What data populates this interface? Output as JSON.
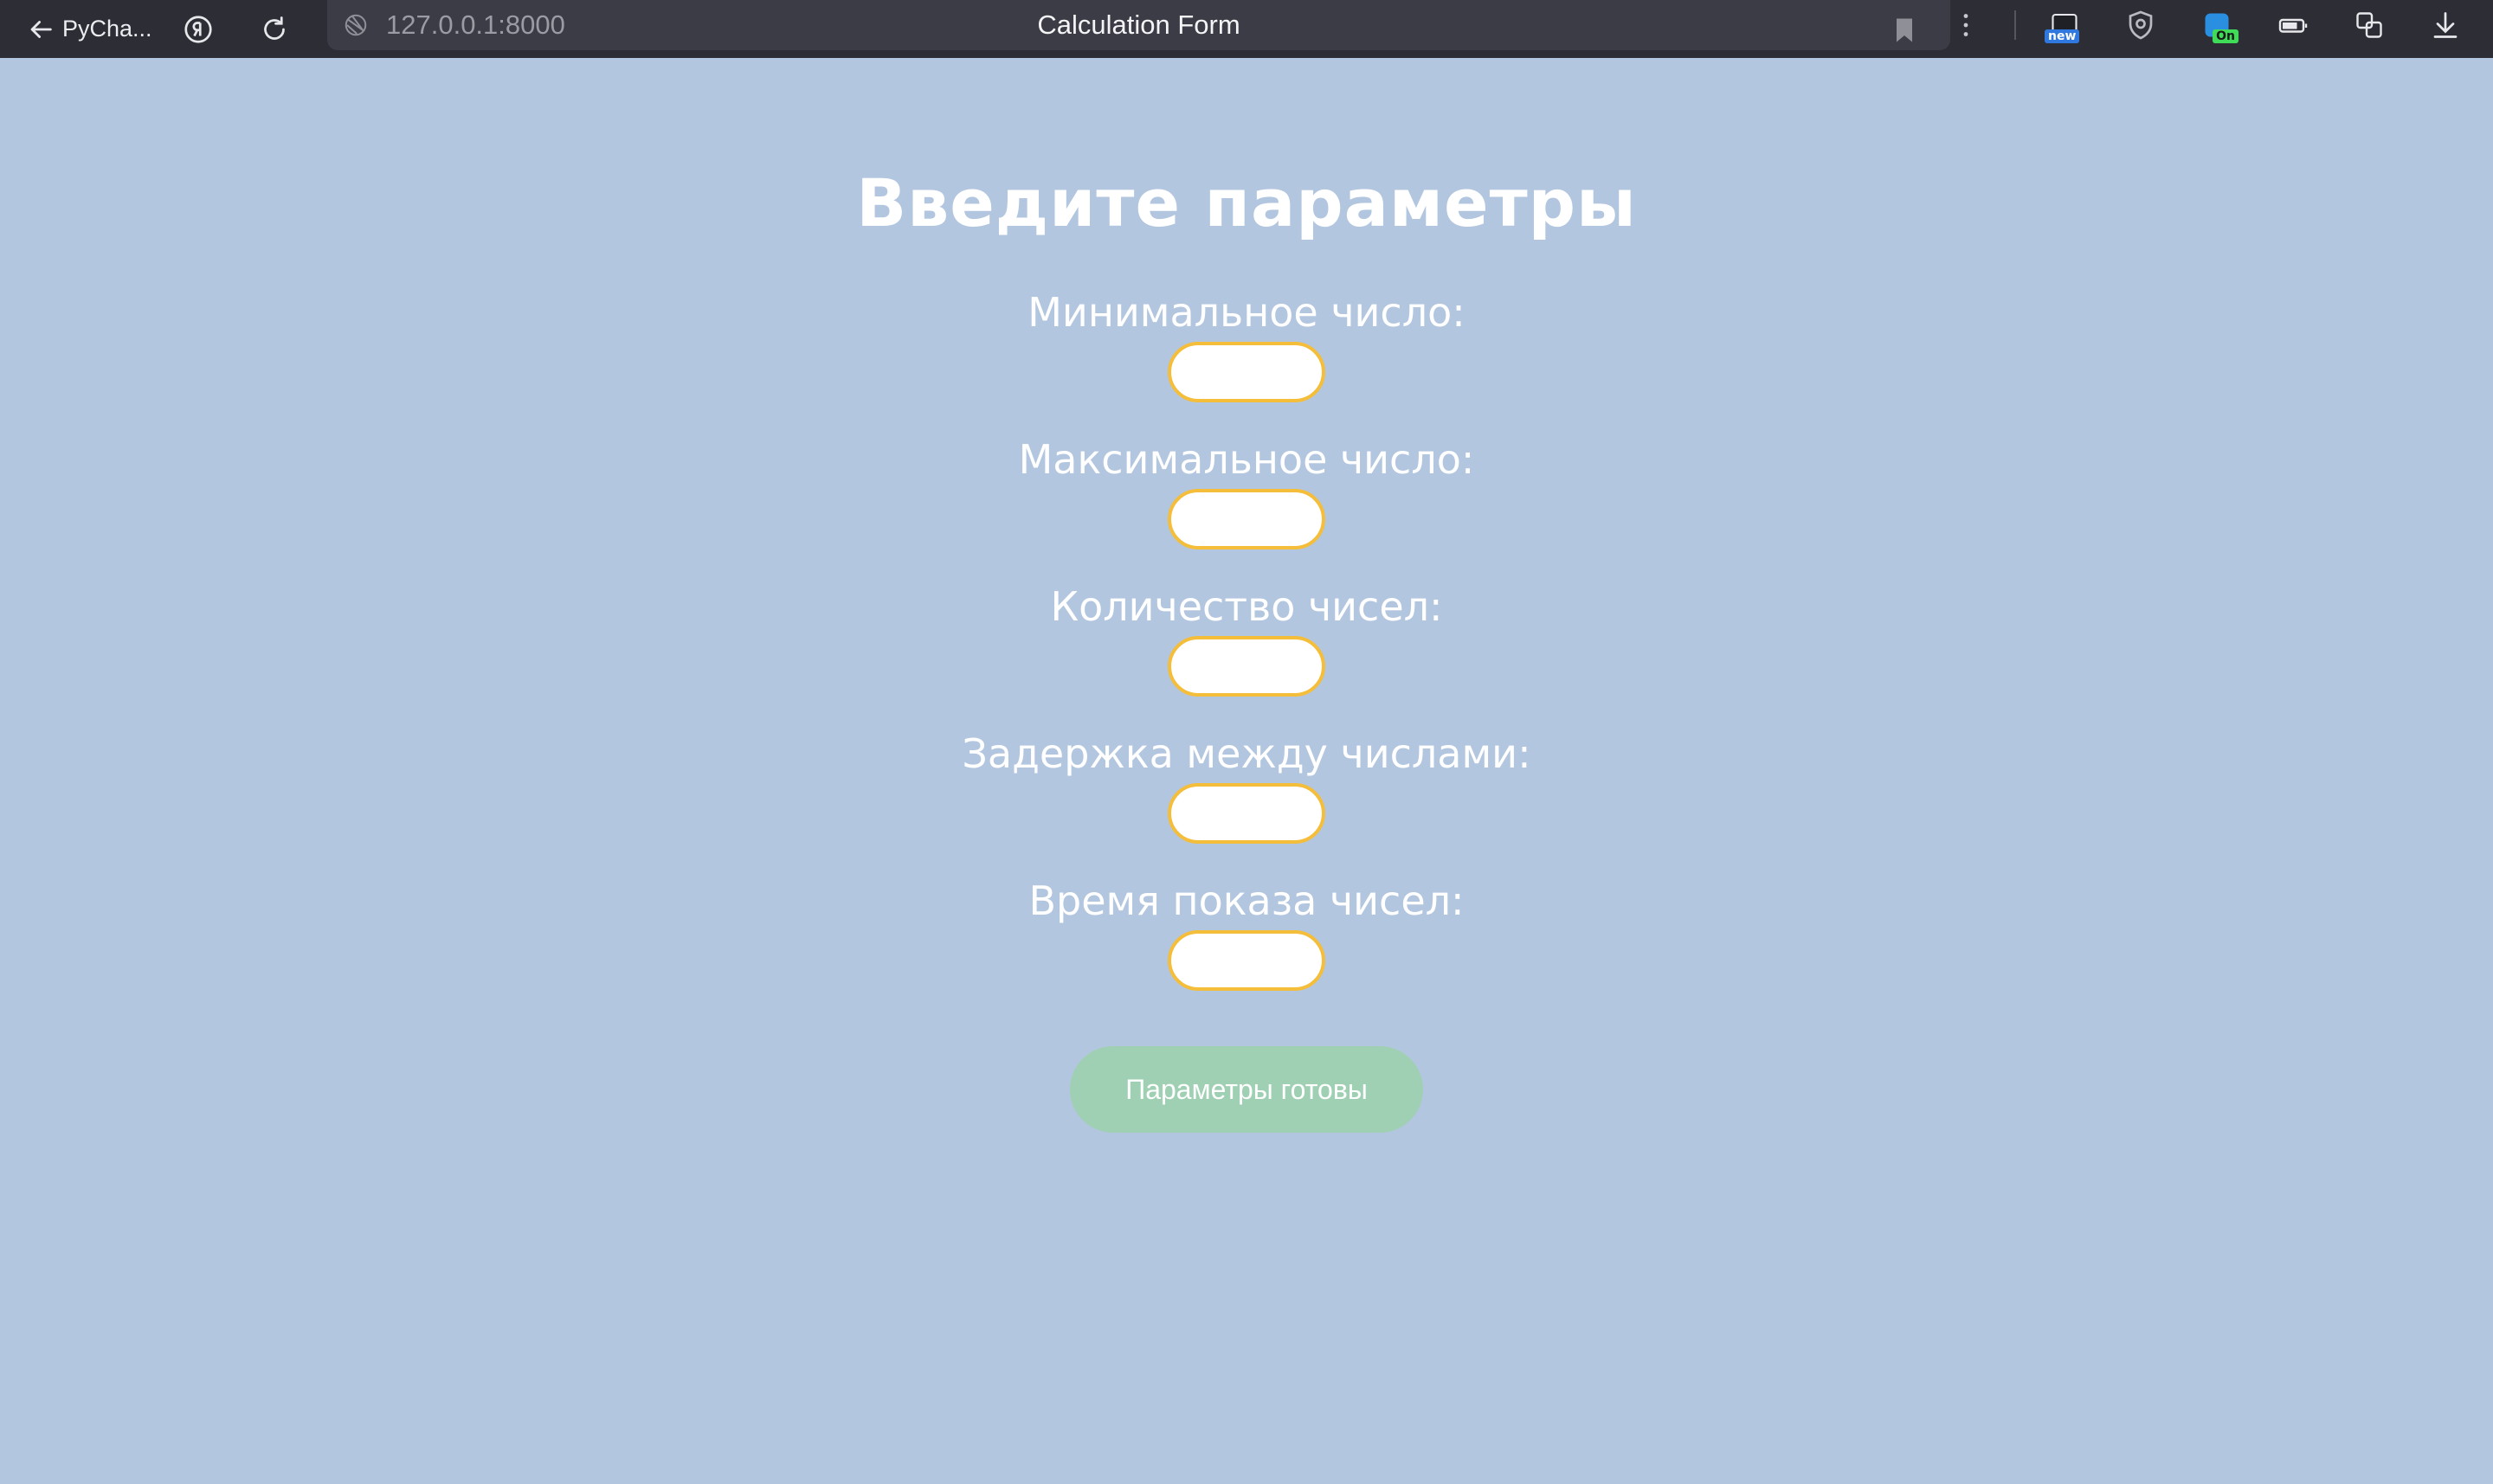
{
  "browser": {
    "back_label": "PyCha...",
    "url": "127.0.0.1:8000",
    "tab_title": "Calculation Form",
    "ext_new_badge": "new",
    "ext_on_badge": "On"
  },
  "form": {
    "title": "Введите параметры",
    "fields": [
      {
        "label": "Минимальное число:",
        "value": ""
      },
      {
        "label": "Максимальное число:",
        "value": ""
      },
      {
        "label": "Количество чисел:",
        "value": ""
      },
      {
        "label": "Задержка между числами:",
        "value": ""
      },
      {
        "label": "Время показа чисел:",
        "value": ""
      }
    ],
    "submit_label": "Параметры готовы"
  },
  "colors": {
    "background": "#b3c6df",
    "input_border": "#f4bd3a",
    "button": "#9fd0b3",
    "topbar": "#2c2d35"
  }
}
